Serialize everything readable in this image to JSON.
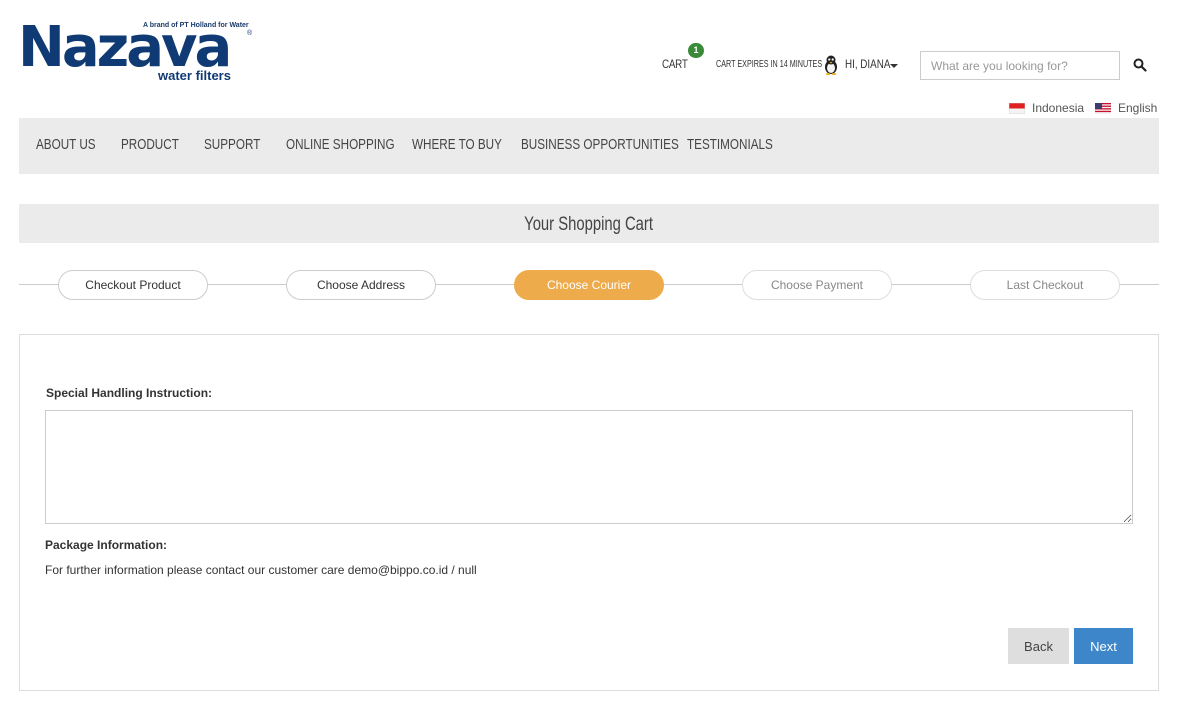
{
  "logo": {
    "tagline": "A brand of PT Holland for Water",
    "wordmark": "Nazava",
    "registered": "®",
    "sub": "water filters"
  },
  "header": {
    "cart_label": "CART",
    "cart_count": "1",
    "cart_expires": "CART EXPIRES IN 14 MINUTES",
    "greeting": "HI, DIANA",
    "search_placeholder": "What are you looking for?"
  },
  "languages": [
    {
      "label": "Indonesia",
      "flag": "flag-indonesia-icon"
    },
    {
      "label": "English",
      "flag": "flag-us-icon"
    }
  ],
  "nav": {
    "items": [
      {
        "label": "ABOUT US"
      },
      {
        "label": "PRODUCT"
      },
      {
        "label": "SUPPORT"
      },
      {
        "label": "ONLINE SHOPPING"
      },
      {
        "label": "WHERE TO BUY"
      },
      {
        "label": "BUSINESS OPPORTUNITIES"
      },
      {
        "label": "TESTIMONIALS"
      }
    ]
  },
  "cart_title": "Your Shopping Cart",
  "steps": [
    {
      "label": "Checkout Product",
      "state": "done"
    },
    {
      "label": "Choose Address",
      "state": "done"
    },
    {
      "label": "Choose Courier",
      "state": "active"
    },
    {
      "label": "Choose Payment",
      "state": "pending"
    },
    {
      "label": "Last Checkout",
      "state": "pending"
    }
  ],
  "form": {
    "special_label": "Special Handling Instruction:",
    "special_value": "",
    "package_label": "Package Information:",
    "contact_text": "For further information please contact our customer care demo@bippo.co.id / null",
    "back_label": "Back",
    "next_label": "Next"
  },
  "colors": {
    "brand": "#0f3a73",
    "active_step": "#eeab4b",
    "primary_button": "#3d86c9",
    "badge": "#3a8a3a"
  }
}
